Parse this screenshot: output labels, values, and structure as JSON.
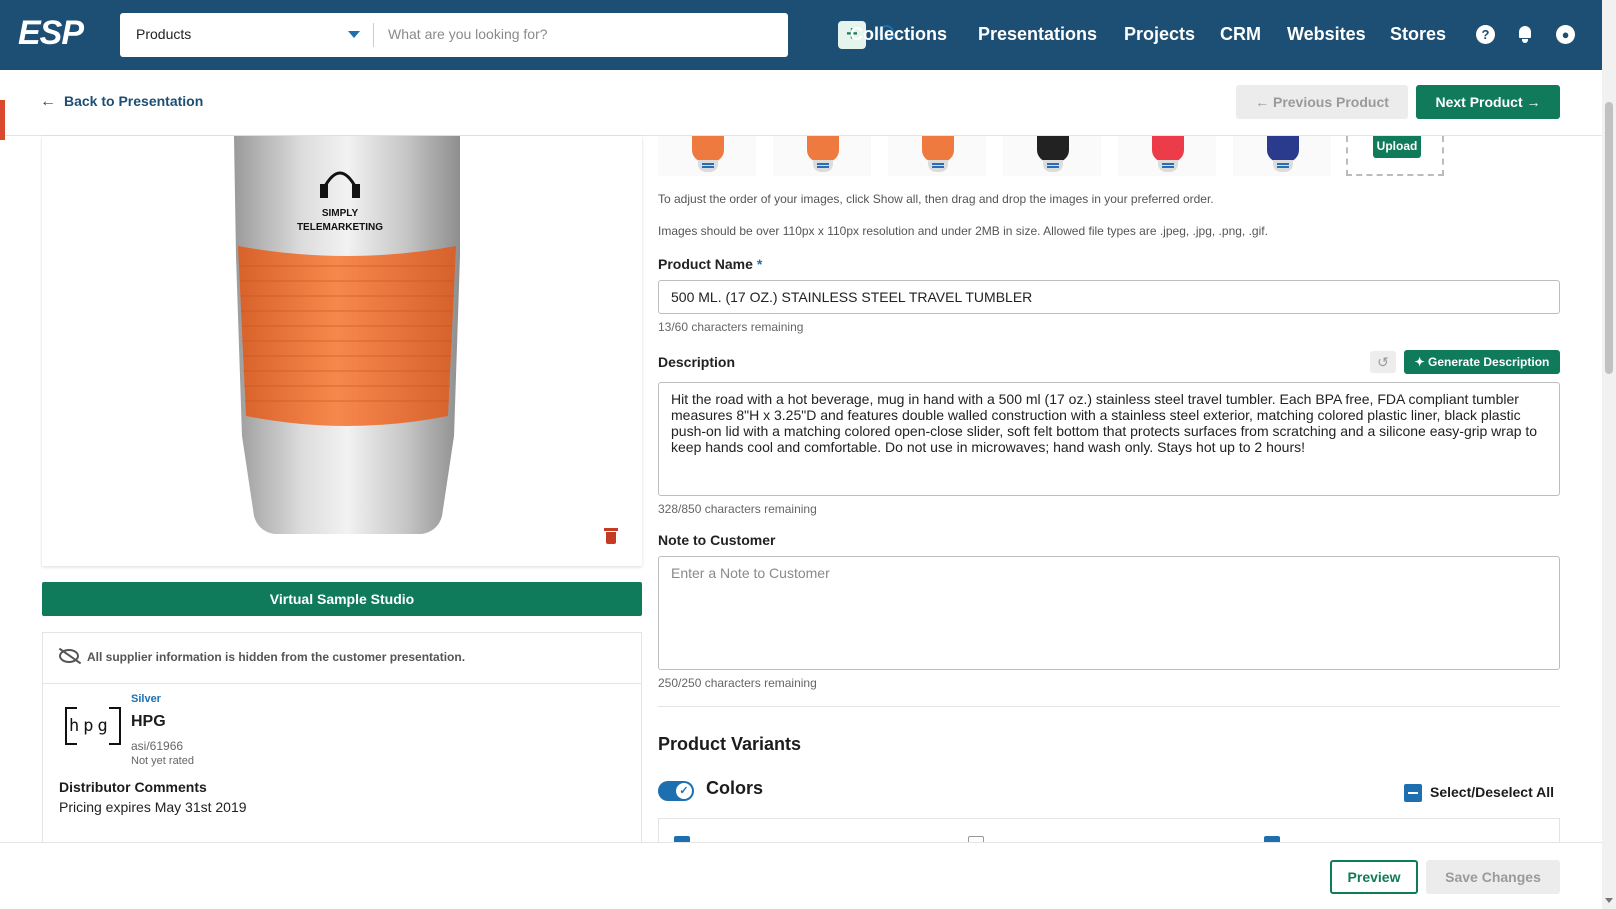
{
  "header": {
    "logo": "ESP",
    "search_type": "Products",
    "search_placeholder": "What are you looking for?",
    "nav": [
      "Collections",
      "Presentations",
      "Projects",
      "CRM",
      "Websites",
      "Stores"
    ]
  },
  "subheader": {
    "back_label": "Back to Presentation",
    "prev_label": "Previous Product",
    "next_label": "Next Product"
  },
  "product_image": {
    "imprint_line1": "SIMPLY",
    "imprint_line2": "TELEMARKETING"
  },
  "left": {
    "vss_label": "Virtual Sample Studio",
    "supplier_hidden_note": "All supplier information is hidden from the customer presentation.",
    "supplier": {
      "tier": "Silver",
      "name": "HPG",
      "asi": "asi/61966",
      "rating": "Not yet rated",
      "logo_text": "hpg"
    },
    "distributor_comments_label": "Distributor Comments",
    "distributor_comments": "Pricing expires May 31st 2019"
  },
  "thumbnails": {
    "colors": [
      "#ee7a3f",
      "#ee7a3f",
      "#ee7a3f",
      "#222222",
      "#ec3c4a",
      "#2a3a8c"
    ],
    "upload_label": "Upload"
  },
  "form": {
    "reorder_help": "To adjust the order of your images, click Show all, then drag and drop the images in your preferred order.",
    "size_help": "Images should be over 110px x 110px resolution and under 2MB in size. Allowed file types are .jpeg, .jpg, .png, .gif.",
    "product_name_label": "Product Name",
    "product_name_required": "*",
    "product_name": "500 ML. (17 OZ.) STAINLESS STEEL TRAVEL TUMBLER",
    "product_name_counter": "13/60 characters remaining",
    "description_label": "Description",
    "generate_label": "Generate Description",
    "description": "Hit the road with a hot beverage, mug in hand with a 500 ml (17 oz.) stainless steel travel tumbler. Each BPA free, FDA compliant tumbler measures 8\"H x 3.25\"D and features double walled construction with a stainless steel exterior, matching colored plastic liner, black plastic push-on lid with a matching colored open-close slider, soft felt bottom that protects surfaces from scratching and a silicone easy-grip wrap to keep hands cool and comfortable. Do not use in microwaves; hand wash only. Stays hot up to 2 hours!",
    "description_counter": "328/850 characters remaining",
    "note_label": "Note to Customer",
    "note_placeholder": "Enter a Note to Customer",
    "note_counter": "250/250 characters remaining"
  },
  "variants": {
    "title": "Product Variants",
    "colors_label": "Colors",
    "select_all_label": "Select/Deselect All"
  },
  "footer": {
    "preview_label": "Preview",
    "save_label": "Save Changes"
  },
  "colors": {
    "brand_blue": "#1d4e74",
    "accent_green": "#107b5a",
    "link_blue": "#1d6fb0"
  }
}
